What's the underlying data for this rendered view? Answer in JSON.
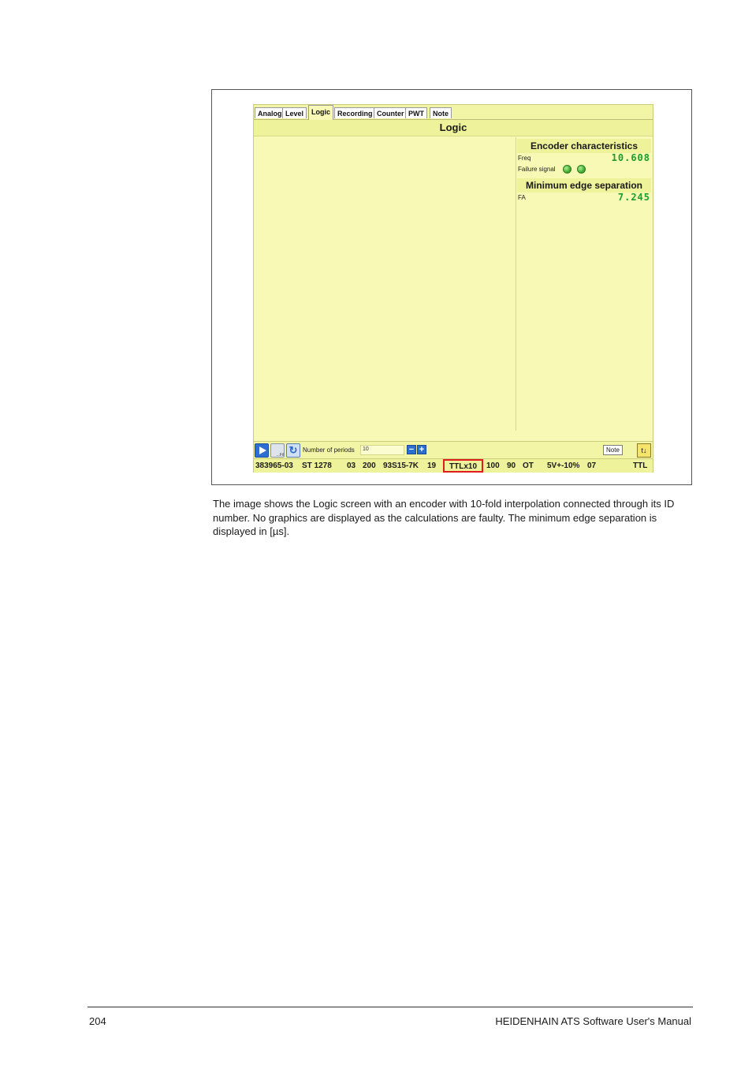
{
  "app": {
    "tabs": [
      "Analog",
      "Level",
      "Logic",
      "Recording",
      "Counter",
      "PWT",
      "Note"
    ],
    "active_tab": "Logic",
    "title": "Logic",
    "encoder": {
      "title": "Encoder characteristics",
      "freq_label": "Freq",
      "freq_value": "10.608",
      "failure_label": "Failure signal"
    },
    "min_edge": {
      "title": "Minimum edge separation",
      "fa_label": "FA",
      "fa_value": "7.245"
    },
    "toolbar": {
      "periods_label": "Number of periods",
      "periods_value": "10",
      "note_label": "Note",
      "save_sub": "...Fil",
      "exit_icon": "t↓"
    },
    "status": [
      "383965-03",
      "ST 1278",
      "03",
      "200",
      "93S15-7K",
      "19",
      "TTLx10",
      "100",
      "90",
      "OT",
      "5V+-10%",
      "07",
      "TTL"
    ]
  },
  "caption": "The image shows the Logic screen with an encoder with 10-fold interpolation connected through its ID number. No graphics are displayed as the calculations are faulty. The minimum edge separation is displayed in [µs].",
  "footer": {
    "page_number": "204",
    "manual_title": "HEIDENHAIN ATS Software User's Manual"
  }
}
